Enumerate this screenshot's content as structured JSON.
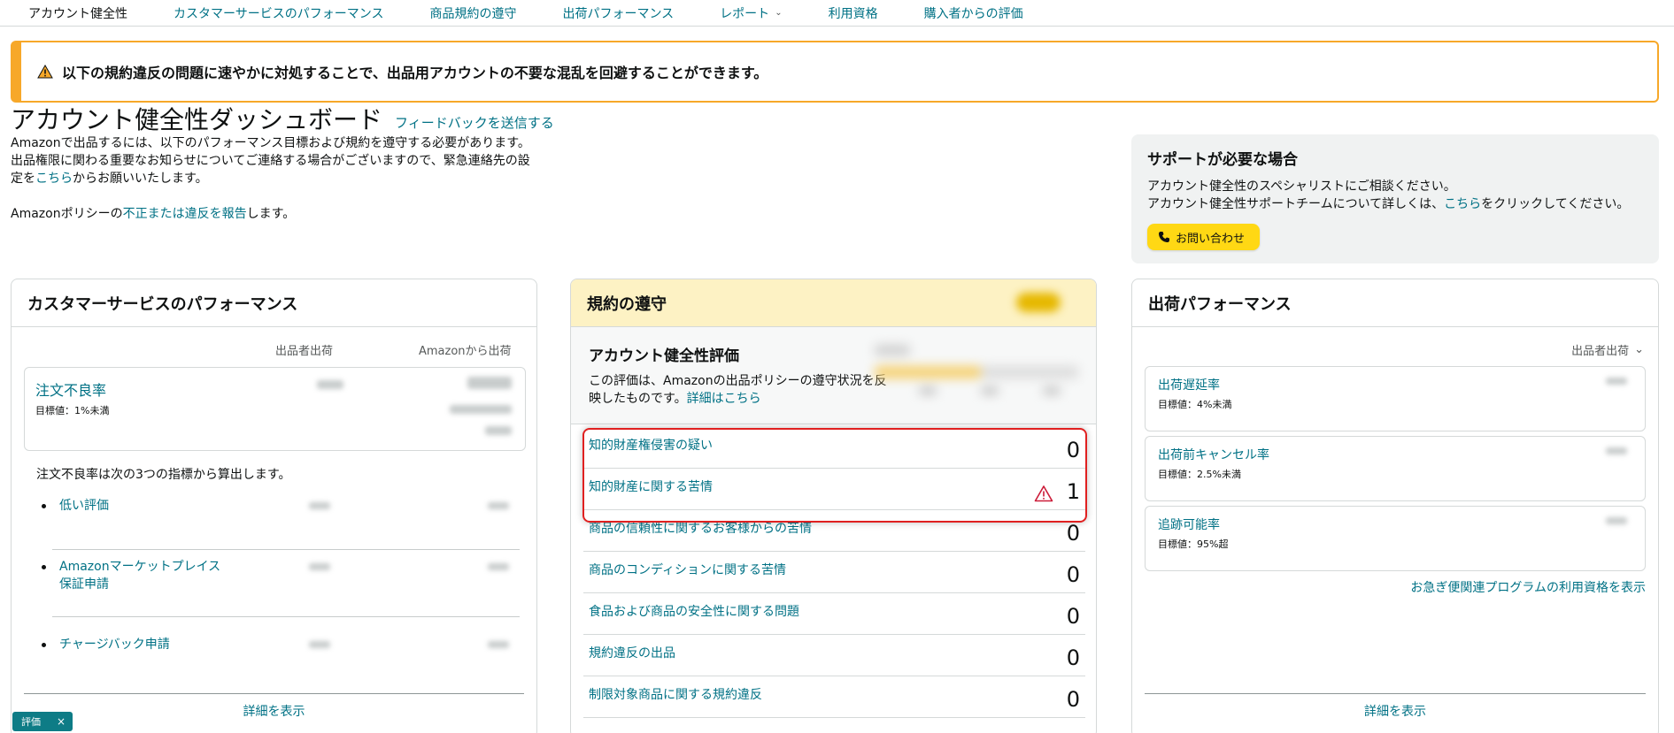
{
  "nav": {
    "items": [
      {
        "label": "アカウント健全性",
        "active": true
      },
      {
        "label": "カスタマーサービスのパフォーマンス"
      },
      {
        "label": "商品規約の遵守"
      },
      {
        "label": "出荷パフォーマンス"
      },
      {
        "label": "レポート",
        "dropdown": true
      },
      {
        "label": "利用資格"
      },
      {
        "label": "購入者からの評価"
      }
    ]
  },
  "alert": {
    "text": "以下の規約違反の問題に速やかに対処することで、出品用アカウントの不要な混乱を回避することができます。",
    "color": "#f7a829"
  },
  "header": {
    "title": "アカウント健全性ダッシュボード",
    "feedback": "フィードバックを送信する",
    "intro_line1": "Amazonで出品するには、以下のパフォーマンス目標および規約を遵守する必要があります。",
    "intro_line2": "出品権限に関わる重要なお知らせについてご連絡する場合がございますので、緊急連絡先の設",
    "intro_line3_pre": "定を",
    "intro_line3_link": "こちら",
    "intro_line3_post": "からお願いいたします。",
    "report_pre": "Amazonポリシーの",
    "report_link": "不正または違反を報告",
    "report_post": "します。"
  },
  "support": {
    "title": "サポートが必要な場合",
    "line1": "アカウント健全性のスペシャリストにご相談ください。",
    "line2_pre": "アカウント健全性サポートチームについて詳しくは、",
    "line2_link": "こちら",
    "line2_post": "をクリックしてください。",
    "button": "お問い合わせ"
  },
  "cs_panel": {
    "title": "カスタマーサービスのパフォーマンス",
    "col1": "出品者出荷",
    "col2": "Amazonから出荷",
    "odr_title": "注文不良率",
    "odr_target": "目標値：1%未満",
    "calc_note": "注文不良率は次の3つの指標から算出します。",
    "metrics": [
      "低い評価",
      "Amazonマーケットプレイス",
      "保証申請",
      "チャージバック申請"
    ],
    "details": "詳細を表示"
  },
  "policy_panel": {
    "title": "規約の遵守",
    "rating_title": "アカウント健全性評価",
    "rating_desc_pre": "この評価は、Amazonの出品ポリシーの遵守状況を反映したものです。",
    "rating_desc_link": "詳細はこちら",
    "rows": [
      {
        "label": "知的財産権侵害の疑い",
        "value": "0"
      },
      {
        "label": "知的財産に関する苦情",
        "value": "1",
        "warning": true
      },
      {
        "label": "商品の信頼性に関するお客様からの苦情",
        "value": "0"
      },
      {
        "label": "商品のコンディションに関する苦情",
        "value": "0"
      },
      {
        "label": "食品および商品の安全性に関する問題",
        "value": "0"
      },
      {
        "label": "規約違反の出品",
        "value": "0"
      },
      {
        "label": "制限対象商品に関する規約違反",
        "value": "0"
      }
    ]
  },
  "ship_panel": {
    "title": "出荷パフォーマンス",
    "seller": "出品者出荷",
    "cards": [
      {
        "title": "出荷遅延率",
        "target": "目標値：4%未満"
      },
      {
        "title": "出荷前キャンセル率",
        "target": "目標値：2.5%未満"
      },
      {
        "title": "追跡可能率",
        "target": "目標値：95%超"
      }
    ],
    "prime_link": "お急ぎ便関連プログラムの利用資格を表示",
    "details": "詳細を表示"
  },
  "chip": {
    "label": "評価",
    "close": "×"
  }
}
